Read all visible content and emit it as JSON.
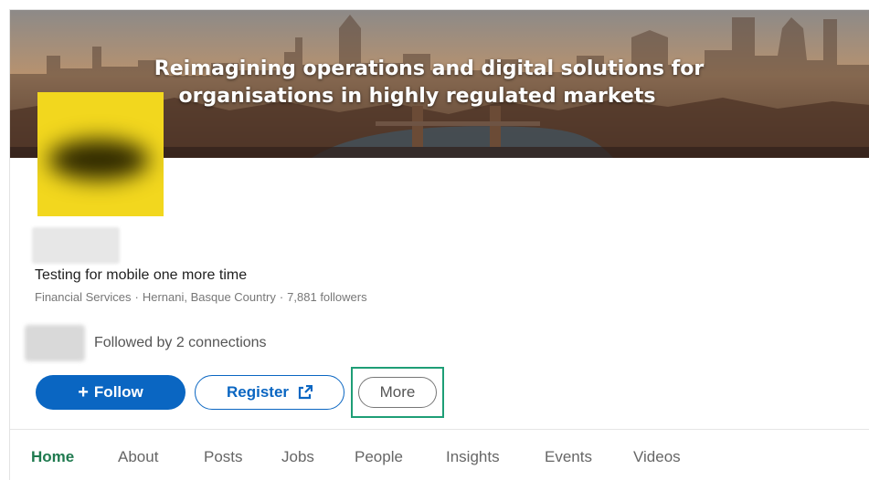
{
  "banner": {
    "line1": "Reimagining operations and digital solutions for",
    "line2": "organisations in highly regulated markets"
  },
  "company": {
    "tagline": "Testing for mobile one more time",
    "industry": "Financial Services",
    "location": "Hernani, Basque Country",
    "followers": "7,881 followers",
    "separator": "·"
  },
  "connections": {
    "text": "Followed by 2 connections"
  },
  "actions": {
    "follow_label": "Follow",
    "follow_icon": "+",
    "register_label": "Register",
    "more_label": "More"
  },
  "tabs": [
    {
      "label": "Home"
    },
    {
      "label": "About"
    },
    {
      "label": "Posts"
    },
    {
      "label": "Jobs"
    },
    {
      "label": "People"
    },
    {
      "label": "Insights"
    },
    {
      "label": "Events"
    },
    {
      "label": "Videos"
    }
  ],
  "colors": {
    "primary": "#0a66c2",
    "active_tab": "#1f7a4f",
    "highlight": "#1e9e76",
    "logo": "#f2d71e"
  }
}
